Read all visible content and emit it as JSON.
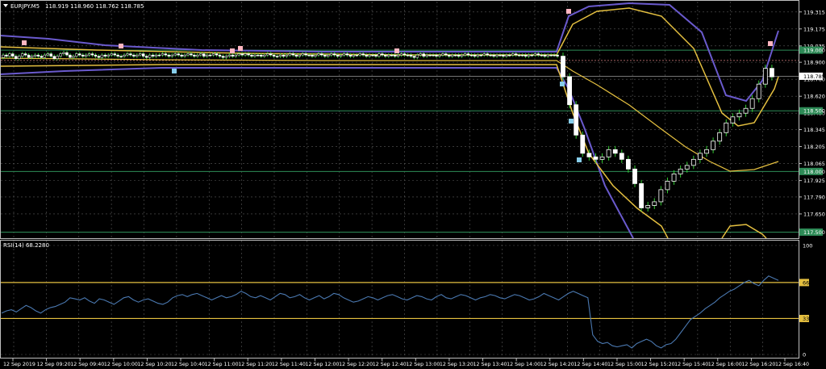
{
  "header": {
    "symbol": "EURJPY.M5",
    "ohlc": "118.919 118.960 118.762 118.785"
  },
  "colors": {
    "background": "#000000",
    "grid": "#5a5a5a",
    "text": "#ffffff",
    "bull_candle": "#ffffff",
    "bear_candle": "#ffffff",
    "wick": "#32cd32",
    "bollinger_wide": "#6a5acd",
    "bollinger_narrow": "#e5c040",
    "horizontal_level": "#2e8b57",
    "rsi_line": "#4a78b0",
    "rsi_level": "#e5c040",
    "arrow_up": "#ffb6c1",
    "arrow_down": "#87ceeb"
  },
  "chart_data": [
    {
      "type": "line",
      "panel": "price",
      "ylim": [
        117.45,
        119.4
      ],
      "price_axis_ticks": [
        "119.315",
        "119.175",
        "119.035",
        "118.900",
        "118.760",
        "118.620",
        "118.480",
        "118.345",
        "118.205",
        "118.065",
        "117.925",
        "117.790",
        "117.650"
      ],
      "level_labels": [
        "119.000",
        "118.500",
        "118.000",
        "117.500"
      ],
      "levels": [
        119.0,
        118.5,
        118.0,
        117.5
      ],
      "current_price_label": "118.785",
      "current_price": 118.785,
      "dotted_price": 118.915,
      "time_labels": [
        "12 Sep 2019",
        "12 Sep 09:20",
        "12 Sep 09:40",
        "12 Sep 10:00",
        "12 Sep 10:20",
        "12 Sep 10:40",
        "12 Sep 11:00",
        "12 Sep 11:20",
        "12 Sep 11:40",
        "12 Sep 12:00",
        "12 Sep 12:20",
        "12 Sep 12:40",
        "12 Sep 13:00",
        "12 Sep 13:20",
        "12 Sep 13:40",
        "12 Sep 14:00",
        "12 Sep 14:20",
        "12 Sep 14:40",
        "12 Sep 15:00",
        "12 Sep 15:20",
        "12 Sep 15:40",
        "12 Sep 16:00",
        "12 Sep 16:20",
        "12 Sep 16:40"
      ],
      "candle_close": [
        118.94,
        118.96,
        118.95,
        118.97,
        118.95,
        118.93,
        118.95,
        118.97,
        118.96,
        118.94,
        118.95,
        118.96,
        118.95,
        118.94,
        118.96,
        118.97,
        118.95,
        118.93,
        118.95,
        118.97,
        118.98,
        118.96,
        118.94,
        118.95,
        118.97,
        118.96,
        118.95,
        118.96,
        118.97,
        118.96,
        118.95,
        118.94,
        118.96,
        118.95,
        118.96,
        118.97,
        118.96,
        118.95,
        118.95,
        118.96,
        118.97,
        118.96,
        118.95,
        118.96,
        118.97,
        118.95,
        118.94,
        118.96,
        118.95,
        118.96,
        118.96,
        118.97,
        118.96,
        118.95,
        118.96,
        118.97,
        118.96,
        118.95,
        118.96,
        118.97,
        118.96,
        118.95,
        118.96,
        118.97,
        118.95,
        118.96,
        118.96,
        118.97,
        118.96,
        118.95,
        118.94,
        118.95,
        118.96,
        118.95,
        118.96,
        118.97,
        118.96,
        118.97,
        118.96,
        118.95,
        118.96,
        118.96,
        118.95,
        118.96,
        118.97,
        118.96,
        118.95,
        118.95,
        118.96,
        118.95,
        118.96,
        118.97,
        118.96,
        118.95,
        118.96,
        118.97,
        118.96,
        118.96,
        118.95,
        118.96,
        118.97,
        118.96,
        118.95,
        118.96,
        118.97,
        118.96,
        118.95,
        118.96,
        118.97,
        118.96,
        118.95,
        118.96,
        118.96,
        118.97,
        118.96,
        118.95,
        118.96,
        118.96,
        118.95,
        118.97,
        118.96,
        118.95,
        118.96,
        118.96,
        118.95,
        118.96,
        118.97,
        118.96,
        118.96,
        118.95,
        118.94,
        118.96,
        118.97,
        118.95,
        118.96,
        118.96,
        118.96,
        118.95,
        118.96,
        118.97,
        118.96,
        118.95,
        118.96,
        118.96,
        118.95,
        118.96,
        118.97,
        118.96,
        118.96,
        118.95,
        118.96,
        118.96,
        118.97,
        118.96,
        118.96,
        118.95,
        118.96,
        118.96,
        118.95,
        118.96,
        118.96,
        118.97,
        118.96,
        118.96,
        118.96,
        118.95,
        118.96,
        118.96,
        118.97,
        118.96,
        118.96,
        118.95,
        118.96,
        118.96,
        118.96,
        118.95,
        118.96,
        118.96,
        118.97,
        118.96,
        118.96,
        118.95,
        118.96,
        118.97,
        118.96,
        118.96,
        118.95,
        118.96,
        118.96,
        118.96,
        118.95,
        118.96,
        118.97,
        118.96,
        118.96,
        118.96,
        118.95,
        118.96,
        118.96,
        118.96,
        118.97,
        118.96,
        118.96,
        118.95,
        118.96,
        118.96,
        118.96,
        118.96,
        118.97,
        118.96,
        118.96
      ],
      "spike_segment": {
        "open": [
          118.95,
          118.78,
          118.55,
          118.3,
          118.15,
          118.12,
          118.1,
          118.12,
          118.18,
          118.15,
          118.1,
          118.02,
          117.9,
          117.7,
          117.72,
          117.75,
          117.85,
          117.92,
          117.98,
          118.02,
          118.05,
          118.1,
          118.15,
          118.18,
          118.25,
          118.32,
          118.4,
          118.45,
          118.48,
          118.52,
          118.6,
          118.72,
          118.85
        ],
        "close": [
          118.78,
          118.55,
          118.3,
          118.15,
          118.12,
          118.1,
          118.12,
          118.18,
          118.15,
          118.1,
          118.02,
          117.9,
          117.7,
          117.72,
          117.75,
          117.85,
          117.92,
          117.98,
          118.02,
          118.05,
          118.1,
          118.15,
          118.18,
          118.25,
          118.32,
          118.4,
          118.45,
          118.48,
          118.52,
          118.6,
          118.72,
          118.85,
          118.78
        ]
      },
      "series": [
        {
          "name": "",
          "values": []
        }
      ]
    },
    {
      "type": "line",
      "panel": "rsi",
      "title": "RSI(14) 68.2280",
      "ylim": [
        0,
        100
      ],
      "ticks": [
        "100",
        "66",
        "33",
        "0"
      ],
      "levels": [
        66,
        33
      ],
      "values": [
        38,
        40,
        41,
        39,
        42,
        45,
        43,
        40,
        38,
        41,
        43,
        44,
        46,
        48,
        52,
        51,
        50,
        52,
        49,
        47,
        51,
        50,
        48,
        46,
        49,
        52,
        53,
        50,
        48,
        50,
        51,
        49,
        47,
        46,
        48,
        52,
        54,
        55,
        53,
        55,
        56,
        54,
        52,
        50,
        52,
        54,
        52,
        53,
        55,
        58,
        56,
        53,
        52,
        54,
        52,
        50,
        53,
        56,
        55,
        52,
        53,
        55,
        52,
        50,
        52,
        54,
        51,
        53,
        56,
        55,
        52,
        50,
        48,
        49,
        51,
        53,
        52,
        50,
        52,
        54,
        55,
        53,
        51,
        50,
        52,
        54,
        53,
        51,
        50,
        53,
        55,
        52,
        51,
        53,
        55,
        54,
        52,
        50,
        52,
        53,
        55,
        54,
        52,
        51,
        53,
        55,
        54,
        52,
        50,
        51,
        53,
        56,
        54,
        52,
        50,
        53,
        56,
        58,
        56,
        54,
        52,
        18,
        12,
        10,
        11,
        8,
        7,
        8,
        9,
        6,
        10,
        12,
        14,
        12,
        8,
        6,
        9,
        10,
        14,
        20,
        26,
        32,
        35,
        38,
        42,
        45,
        48,
        52,
        55,
        58,
        60,
        63,
        66,
        68,
        65,
        63,
        68,
        72,
        70,
        68
      ]
    }
  ]
}
